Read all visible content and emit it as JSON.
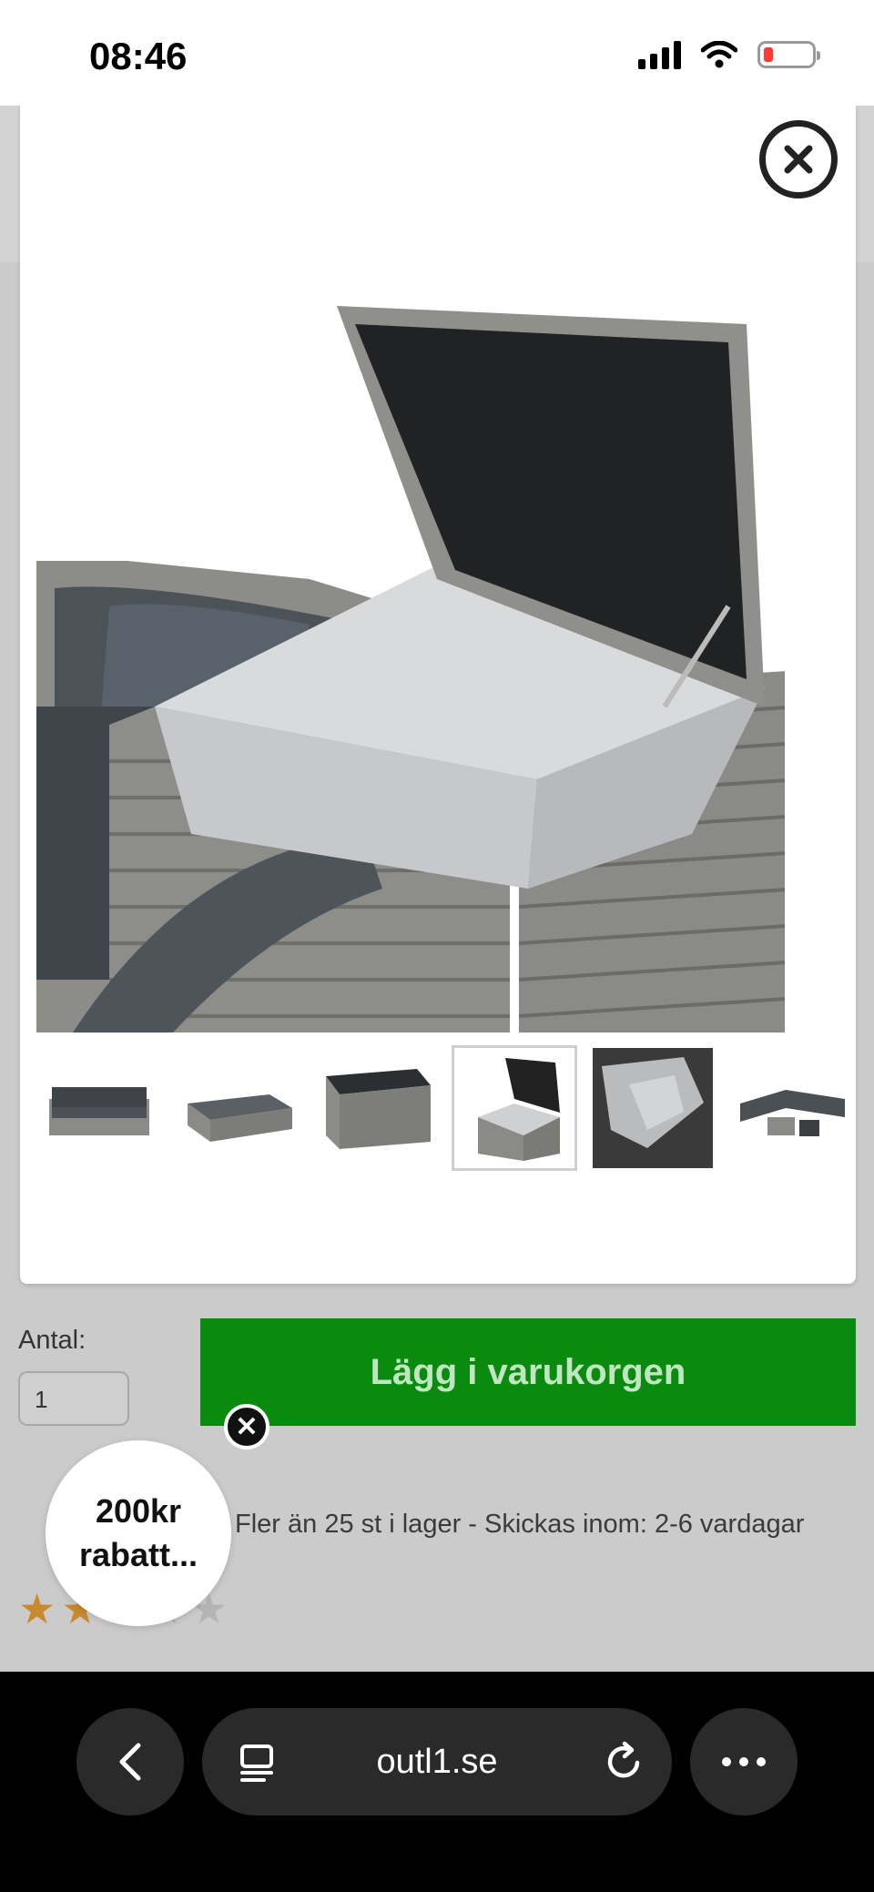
{
  "status": {
    "time": "08:46"
  },
  "modal": {
    "close_icon": "close-icon"
  },
  "purchase": {
    "quantity_label": "Antal:",
    "quantity_value": "1",
    "add_to_cart_label": "Lägg i varukorgen",
    "stock_text": "Fler än 25 st i lager - Skickas inom: 2-6 vardagar",
    "rating_stars": 2,
    "rating_max": 5
  },
  "coupon": {
    "line1": "200kr",
    "line2": "rabatt..."
  },
  "browser": {
    "url": "outl1.se"
  },
  "colors": {
    "add_to_cart": "#0b8a10",
    "star_on": "#c98a2e",
    "browser_bar": "#000000"
  }
}
